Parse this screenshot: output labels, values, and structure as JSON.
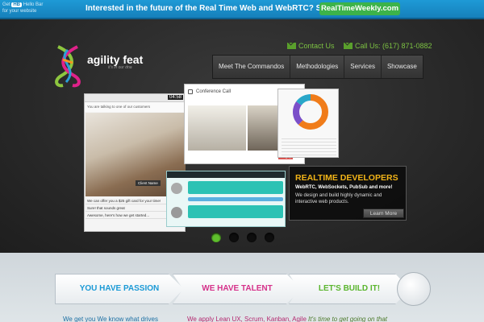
{
  "hellobar": {
    "get_prefix": "Get",
    "get_badge": "HB",
    "get_suffix": "Hello Bar",
    "get_line2": "for your website",
    "message": "Interested in the future of the Real Time Web and WebRTC? So are we!",
    "button": "RealTimeWeekly.com"
  },
  "brand": {
    "name": "agility feat",
    "tagline": "it's in our dna"
  },
  "contact": {
    "email": "Contact Us",
    "phone": "Call Us: (617) 871-0882"
  },
  "nav": [
    "Meet The Commandos",
    "Methodologies",
    "Services",
    "Showcase"
  ],
  "slide": {
    "timer": "04:58",
    "support_header": "You are talking to one of our customers",
    "conf_title": "Conference Call",
    "hangup": "Hang up",
    "chat": [
      "We can offer you a $25 gift card for your time!",
      "Sure! that sounds great",
      "Awesome, here's how we get started..."
    ],
    "client_label": "Client Name"
  },
  "caption": {
    "title": "REALTIME DEVELOPERS",
    "subtitle": "WebRTC, WebSockets, PubSub and more!",
    "desc": "We design and build highly dynamic and interactive web products.",
    "button": "Learn More"
  },
  "slider_dots": 4,
  "steps": [
    "YOU HAVE PASSION",
    "WE HAVE TALENT",
    "LET'S BUILD IT!"
  ],
  "teasers": [
    "We get you We know what drives",
    "We apply Lean UX, Scrum, Kanban, Agile",
    "It's time to get going on that"
  ],
  "colors": {
    "accent_green": "#5fc02d",
    "caption_title": "#f2b418",
    "passion": "#1b9ad6",
    "talent": "#d6318a",
    "build": "#5ab52d"
  }
}
